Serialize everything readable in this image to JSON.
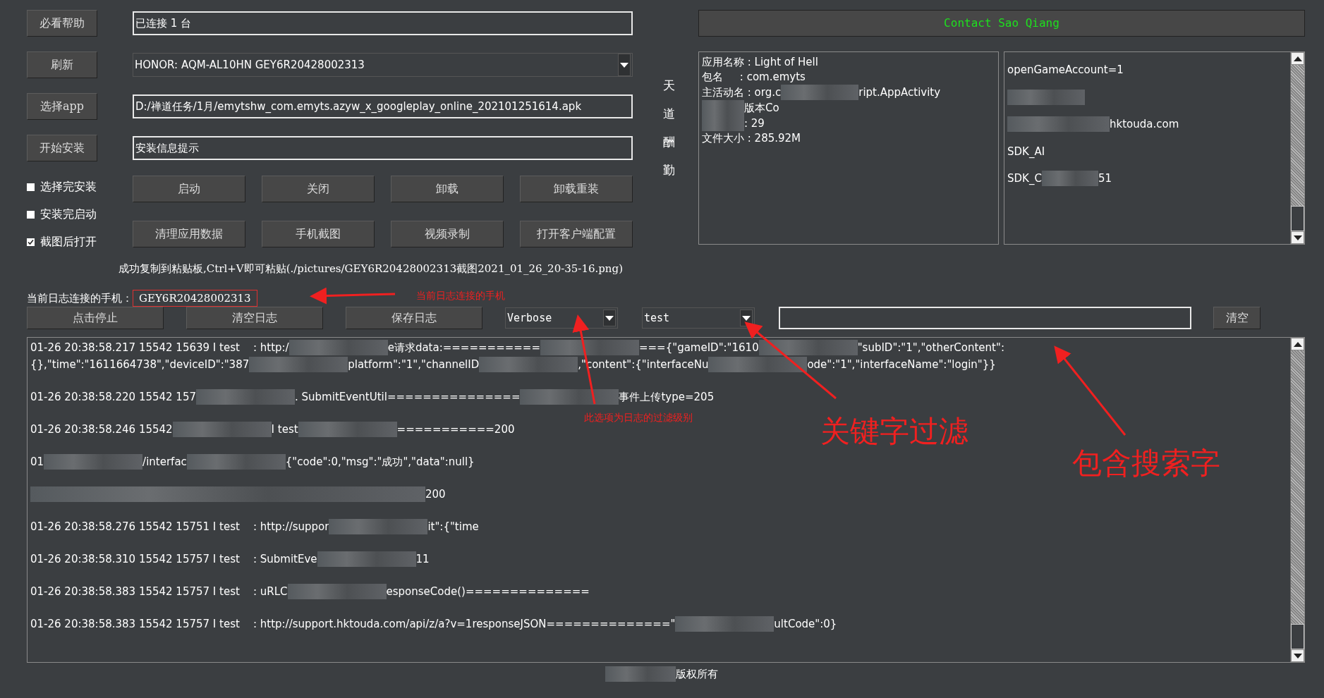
{
  "left_buttons": [
    "必看帮助",
    "刷新",
    "选择app",
    "开始安装"
  ],
  "fields": [
    {
      "kind": "text",
      "value": "已连接 1 台"
    },
    {
      "kind": "select",
      "value": "HONOR: AQM-AL10HN GEY6R20428002313"
    },
    {
      "kind": "text",
      "value": "D:/禅道任务/1月/emytshw_com.emyts.azyw_x_googleplay_online_202101251614.apk"
    },
    {
      "kind": "text",
      "value": "安装信息提示"
    }
  ],
  "options": [
    {
      "label": "选择完安装",
      "checked": false
    },
    {
      "label": "安装完启动",
      "checked": false
    },
    {
      "label": "截图后打开",
      "checked": true
    }
  ],
  "action_buttons": [
    "启动",
    "关闭",
    "卸载",
    "卸载重装",
    "清理应用数据",
    "手机截图",
    "视频录制",
    "打开客户端配置"
  ],
  "motto": "天道酬勤",
  "contact_button": "Contact Sao Qiang",
  "app_info": [
    {
      "parts": [
        "应用名称 : Light of Hell"
      ]
    },
    {
      "parts": [
        "包名     : com.emyts"
      ]
    },
    {
      "parts": [
        "主活动名 : org.c",
        "ript.AppActivity"
      ]
    },
    {
      "parts": [
        "版本Co"
      ]
    },
    {
      "parts": [
        ": 29"
      ]
    },
    {
      "parts": [
        "文件大小 : 285.92M"
      ]
    }
  ],
  "sdk_info": [
    {
      "parts": [
        "openGameAccount=1"
      ]
    },
    {
      "parts": [
        "hktouda.com"
      ]
    },
    {
      "parts": [
        "SDK_AI"
      ]
    },
    {
      "parts": [
        "SDK_C",
        "51"
      ]
    }
  ],
  "status_message": "成功复制到粘贴板,Ctrl+V即可粘贴(./pictures/GEY6R20428002313截图2021_01_26_20-35-16.png)",
  "log_device": {
    "label": "当前日志连接的手机：",
    "value": "GEY6R20428002313"
  },
  "log_buttons": [
    "点击停止",
    "清空日志",
    "保存日志"
  ],
  "log_level": "Verbose",
  "log_tag": "test",
  "clear_button": "清空",
  "log_entries": [
    {
      "lines": [
        {
          "kind": "plain",
          "parts": [
            "01-26 20:38:58.217 15542 15639 I test    : http:/",
            "e请求data:===========",
            "==={\"gameID\":\"1610",
            "\"subID\":\"1\",\"otherContent\":"
          ]
        },
        {
          "kind": "plain",
          "parts": [
            "{},\"time\":\"1611664738\",\"deviceID\":\"387",
            "platform\":\"1\",\"channelID",
            ",\"content\":{\"interfaceNu",
            "ode\":\"1\",\"interfaceName\":\"login\"}}"
          ]
        }
      ]
    },
    {
      "lines": [
        {
          "kind": "plain",
          "parts": [
            "01-26 20:38:58.220 15542 157",
            ". SubmitEventUtil===============",
            "事件上传type=205"
          ]
        }
      ]
    },
    {
      "lines": [
        {
          "kind": "plain",
          "parts": [
            "01-26 20:38:58.246 15542",
            "I test",
            "===========200"
          ]
        }
      ]
    },
    {
      "lines": [
        {
          "kind": "plain",
          "parts": [
            "01",
            "/interfac",
            "{\"code\":0,\"msg\":\"成功\",\"data\":null}"
          ]
        }
      ]
    },
    {
      "lines": [
        {
          "kind": "redacted_start",
          "parts": [
            "200"
          ]
        }
      ]
    },
    {
      "lines": [
        {
          "kind": "plain",
          "parts": [
            "01-26 20:38:58.276 15542 15751 I test    : http://suppor",
            "it\":{\"time"
          ]
        }
      ]
    },
    {
      "lines": [
        {
          "kind": "plain",
          "parts": [
            "01-26 20:38:58.310 15542 15757 I test    : SubmitEve",
            "11"
          ]
        }
      ]
    },
    {
      "lines": [
        {
          "kind": "plain",
          "parts": [
            "01-26 20:38:58.383 15542 15757 I test    : uRLC",
            "esponseCode()=============="
          ]
        }
      ]
    },
    {
      "lines": [
        {
          "kind": "plain",
          "parts": [
            "01-26 20:38:58.383 15542 15757 I test    : http://support.hktouda.com/api/z/a?v=1responseJSON==============\"",
            "ultCode\":0}"
          ]
        }
      ]
    }
  ],
  "footer": "版权所有",
  "annotations": [
    {
      "text": "当前日志连接的手机"
    },
    {
      "text": "此选项为日志的过滤级别"
    },
    {
      "text": "关键字过滤"
    },
    {
      "text": "包含搜索字"
    }
  ]
}
